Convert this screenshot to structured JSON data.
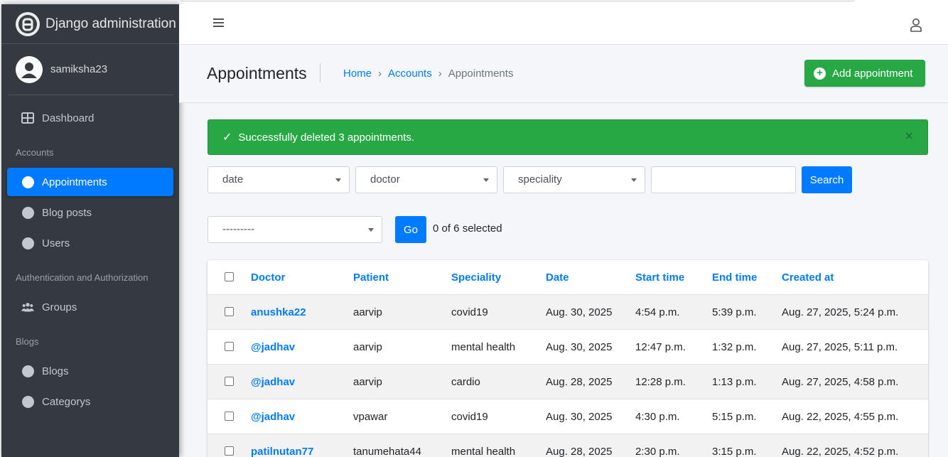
{
  "brand": {
    "title": "Django administration",
    "logo_icon": "django-logo-icon"
  },
  "user": {
    "name": "samiksha23"
  },
  "sidebar": {
    "dashboard": {
      "label": "Dashboard",
      "icon": "dashboard-grid-icon"
    },
    "sections": [
      {
        "header": "Accounts",
        "items": [
          {
            "label": "Appointments",
            "active": true
          },
          {
            "label": "Blog posts",
            "active": false
          },
          {
            "label": "Users",
            "active": false
          }
        ]
      },
      {
        "header": "Authentication and Authorization",
        "items": [
          {
            "label": "Groups",
            "icon": "users-group-icon"
          }
        ]
      },
      {
        "header": "Blogs",
        "items": [
          {
            "label": "Blogs"
          },
          {
            "label": "Categorys"
          }
        ]
      }
    ]
  },
  "header": {
    "title": "Appointments",
    "breadcrumb": {
      "home": "Home",
      "section": "Accounts",
      "current": "Appointments",
      "separator": "›"
    },
    "add_button": "Add appointment"
  },
  "alert": {
    "message": "Successfully deleted 3 appointments.",
    "close": "×",
    "check": "✓"
  },
  "filters": {
    "date": "date",
    "doctor": "doctor",
    "speciality": "speciality",
    "search_value": "",
    "search_button": "Search"
  },
  "actions": {
    "selected": "---------",
    "go_button": "Go",
    "selection_count": "0 of 6 selected"
  },
  "table": {
    "columns": [
      "Doctor",
      "Patient",
      "Speciality",
      "Date",
      "Start time",
      "End time",
      "Created at"
    ],
    "rows": [
      [
        "anushka22",
        "aarvip",
        "covid19",
        "Aug. 30, 2025",
        "4:54 p.m.",
        "5:39 p.m.",
        "Aug. 27, 2025, 5:24 p.m."
      ],
      [
        "@jadhav",
        "aarvip",
        "mental health",
        "Aug. 30, 2025",
        "12:47 p.m.",
        "1:32 p.m.",
        "Aug. 27, 2025, 5:11 p.m."
      ],
      [
        "@jadhav",
        "aarvip",
        "cardio",
        "Aug. 28, 2025",
        "12:28 p.m.",
        "1:13 p.m.",
        "Aug. 27, 2025, 4:58 p.m."
      ],
      [
        "@jadhav",
        "vpawar",
        "covid19",
        "Aug. 30, 2025",
        "4:30 p.m.",
        "5:15 p.m.",
        "Aug. 22, 2025, 4:55 p.m."
      ],
      [
        "patilnutan77",
        "tanumehata44",
        "mental health",
        "Aug. 28, 2025",
        "2:30 p.m.",
        "3:15 p.m.",
        "Aug. 22, 2025, 4:52 p.m."
      ]
    ]
  },
  "colors": {
    "sidebar_bg": "#343a40",
    "primary": "#007bff",
    "success": "#28a745"
  }
}
